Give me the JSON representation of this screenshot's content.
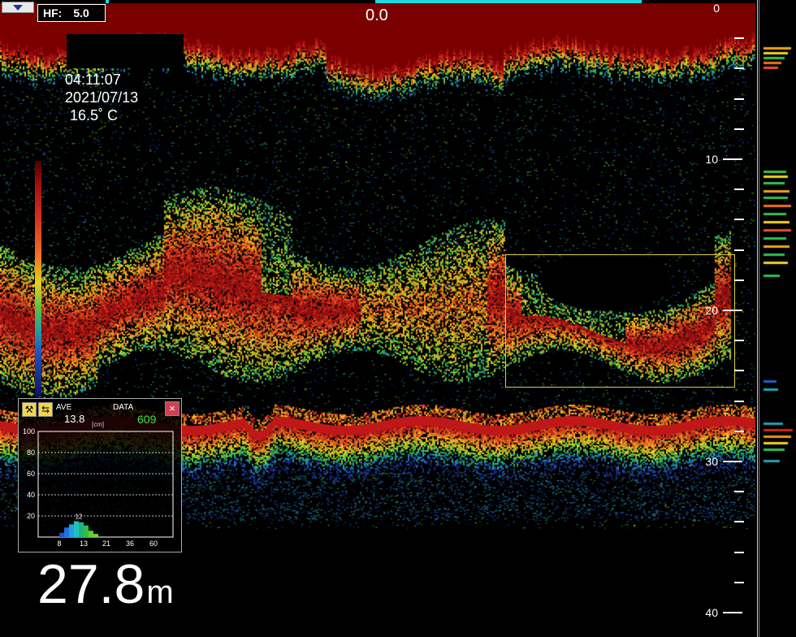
{
  "header": {
    "hf_label": "HF:",
    "hf_value": "5.0",
    "offset": "0.0"
  },
  "info": {
    "time": "04:11:07",
    "date": "2021/07/13",
    "temperature": "16.5˚ C"
  },
  "depth_scale": {
    "labels": [
      "0",
      "10",
      "20",
      "30",
      "40"
    ]
  },
  "panel": {
    "ave_label": "AVE",
    "ave_value": "13.8",
    "unit": "[cm]",
    "data_label": "DATA",
    "data_value": "609",
    "close_icon": "×",
    "y_ticks": [
      "100",
      "80",
      "60",
      "40",
      "20"
    ],
    "x_ticks": [
      "8",
      "13",
      "21",
      "36",
      "60"
    ],
    "peak_label": "12",
    "bins": [
      {
        "size": 9,
        "level": 4,
        "color": "#2050d0"
      },
      {
        "size": 10,
        "level": 9,
        "color": "#2070e0"
      },
      {
        "size": 11,
        "level": 12,
        "color": "#20a0e0"
      },
      {
        "size": 12,
        "level": 15,
        "color": "#20c0c0"
      },
      {
        "size": 13,
        "level": 14,
        "color": "#20b080"
      },
      {
        "size": 14,
        "level": 11,
        "color": "#30c040"
      },
      {
        "size": 15,
        "level": 6,
        "color": "#60d030"
      },
      {
        "size": 16,
        "level": 3,
        "color": "#80d020"
      }
    ]
  },
  "bottom_depth": {
    "value": "27.8",
    "unit": "m"
  },
  "colors": {
    "surface": "#7a0000",
    "bottom": "#c01818",
    "selection": "#d8d040",
    "accent_cyan": "#20d8e0"
  }
}
